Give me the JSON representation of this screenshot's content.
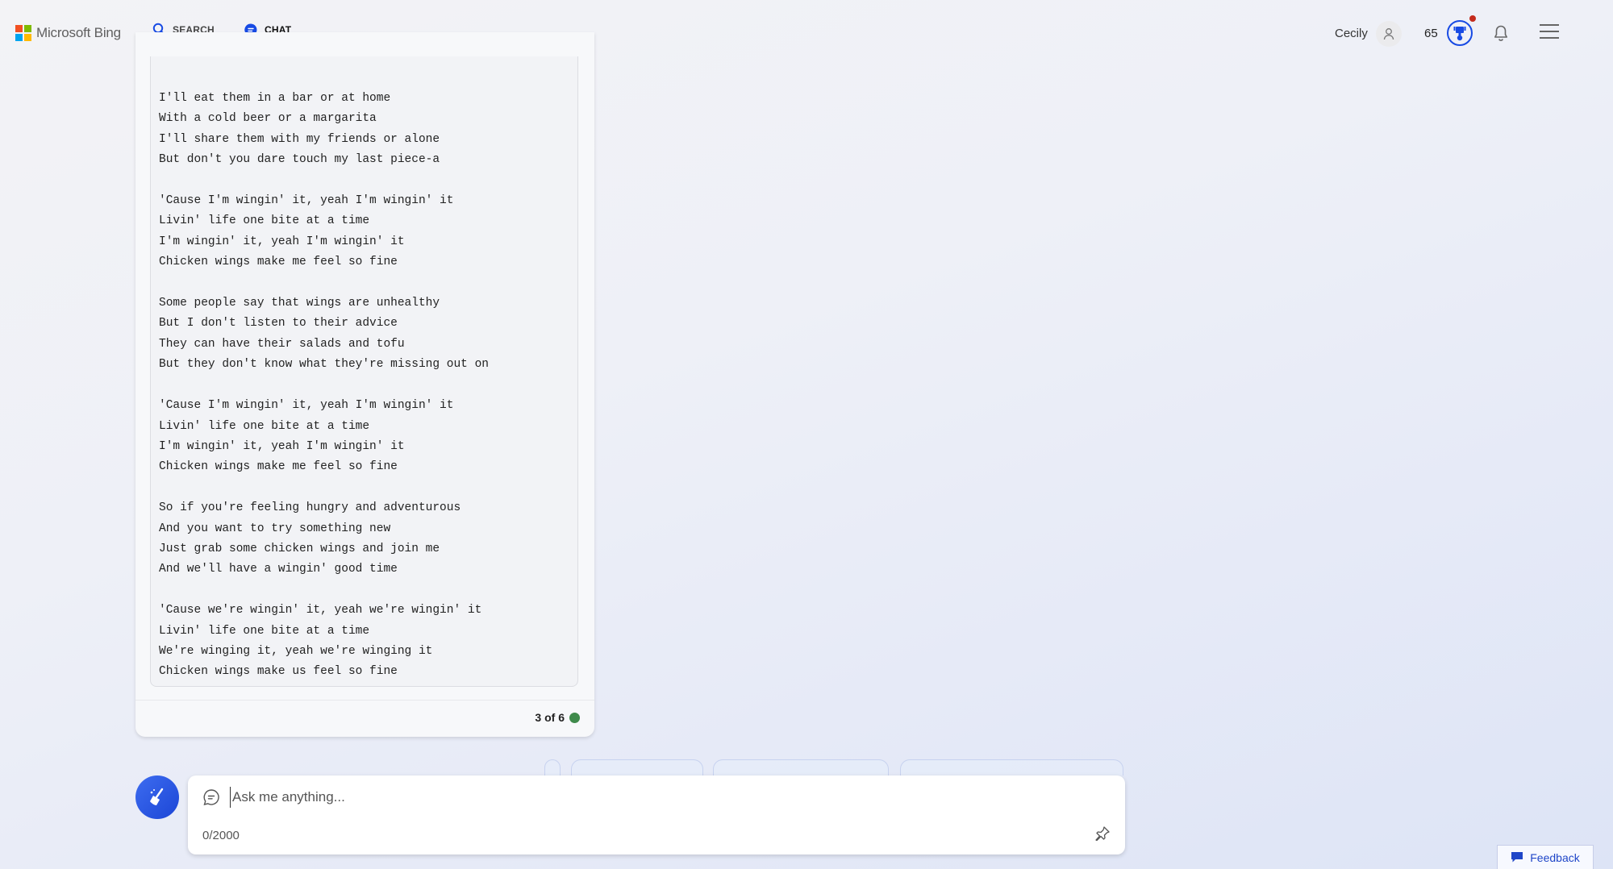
{
  "header": {
    "logo_text": "Microsoft Bing",
    "logo_colors": [
      "#f25022",
      "#7fba00",
      "#00a4ef",
      "#ffb900"
    ],
    "tabs": [
      {
        "label": "SEARCH",
        "icon": "search-icon",
        "active": false
      },
      {
        "label": "CHAT",
        "icon": "chat-icon",
        "active": true
      }
    ],
    "user_name": "Cecily",
    "points": "65",
    "accent_color": "#174ae4"
  },
  "chat": {
    "lyrics_lines": [
      "I'll eat them in a bar or at home",
      "With a cold beer or a margarita",
      "I'll share them with my friends or alone",
      "But don't you dare touch my last piece-a",
      "",
      "'Cause I'm wingin' it, yeah I'm wingin' it",
      "Livin' life one bite at a time",
      "I'm wingin' it, yeah I'm wingin' it",
      "Chicken wings make me feel so fine",
      "",
      "Some people say that wings are unhealthy",
      "But I don't listen to their advice",
      "They can have their salads and tofu",
      "But they don't know what they're missing out on",
      "",
      "'Cause I'm wingin' it, yeah I'm wingin' it",
      "Livin' life one bite at a time",
      "I'm wingin' it, yeah I'm wingin' it",
      "Chicken wings make me feel so fine",
      "",
      "So if you're feeling hungry and adventurous",
      "And you want to try something new",
      "Just grab some chicken wings and join me",
      "And we'll have a wingin' good time",
      "",
      "'Cause we're wingin' it, yeah we're wingin' it",
      "Livin' life one bite at a time",
      "We're winging it, yeah we're winging it",
      "Chicken wings make us feel so fine"
    ],
    "page_indicator": "3 of 6",
    "status_color": "#3f8a4b"
  },
  "input": {
    "placeholder": "Ask me anything...",
    "value": "",
    "char_count": "0/2000"
  },
  "feedback": {
    "label": "Feedback"
  }
}
